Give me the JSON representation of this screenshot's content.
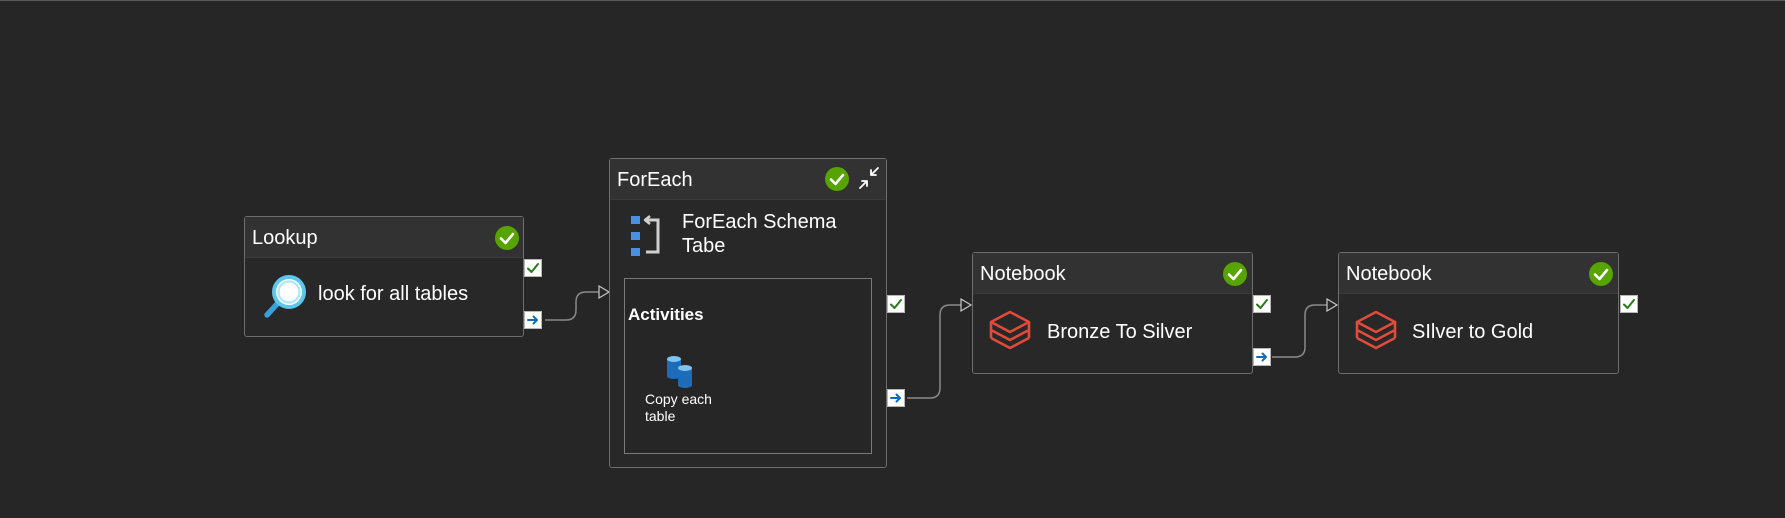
{
  "pipeline": {
    "activities": [
      {
        "type": "Lookup",
        "name": "look for all tables",
        "icon": "magnifier-icon",
        "status": "succeeded"
      },
      {
        "type": "ForEach",
        "name": "ForEach Schema Tabe",
        "icon": "foreach-icon",
        "status": "succeeded",
        "inner": {
          "title": "Activities",
          "children": [
            {
              "name": "Copy each table",
              "icon": "copy-data-icon"
            }
          ]
        }
      },
      {
        "type": "Notebook",
        "name": "Bronze To Silver",
        "icon": "databricks-icon",
        "status": "succeeded"
      },
      {
        "type": "Notebook",
        "name": "SIlver to Gold",
        "icon": "databricks-icon",
        "status": "succeeded"
      }
    ],
    "colors": {
      "canvas": "#262626",
      "success": "#57a300",
      "databricks": "#e04b3b",
      "port_icon": "#0f6cbd"
    }
  }
}
